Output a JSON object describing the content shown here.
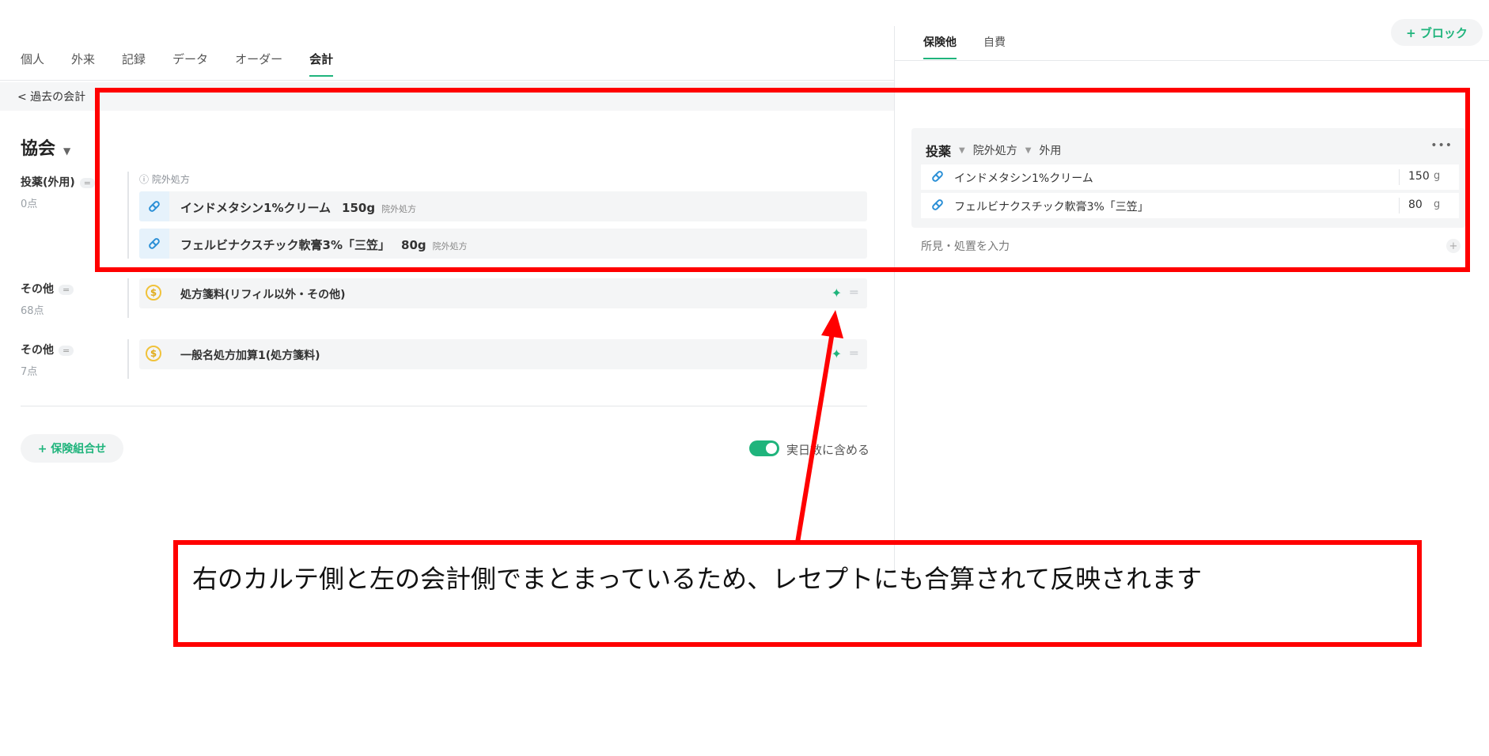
{
  "left_tabs": [
    "個人",
    "外来",
    "記録",
    "データ",
    "オーダー",
    "会計"
  ],
  "back_link": "< 過去の会計",
  "section_title": "協会",
  "groups": [
    {
      "label": "投薬(外用)",
      "points": "0点"
    },
    {
      "label": "その他",
      "points": "68点"
    },
    {
      "label": "その他",
      "points": "7点"
    }
  ],
  "outside_rx_note": "ⓘ 院外処方",
  "meds_left": [
    {
      "name": "インドメタシン1%クリーム",
      "qty": "150g",
      "tag": "院外処方"
    },
    {
      "name": "フェルビナクスチック軟膏3%「三笠」",
      "qty": "80g",
      "tag": "院外処方"
    }
  ],
  "fees": [
    {
      "name": "処方箋料(リフィル以外・その他)"
    },
    {
      "name": "一般名処方加算1(処方箋料)"
    }
  ],
  "add_insurance_combo": "+ 保険組合せ",
  "toggle_label": "実日数に含める",
  "right_tabs": [
    "保険他",
    "自費"
  ],
  "block_button": "+ ブロック",
  "rx_card": {
    "category": "投薬",
    "type": "院外処方",
    "route": "外用",
    "items": [
      {
        "name": "インドメタシン1%クリーム",
        "qty": "150",
        "unit": "g"
      },
      {
        "name": "フェルビナクスチック軟膏3%「三笠」",
        "qty": "80",
        "unit": "g"
      }
    ]
  },
  "findings_placeholder": "所見・処置を入力",
  "annotation_text": "右のカルテ側と左の会計側でまとまっているため、レセプトにも合算されて反映されます",
  "colors": {
    "accent": "#1fb47c",
    "annotation": "#ff0000"
  }
}
